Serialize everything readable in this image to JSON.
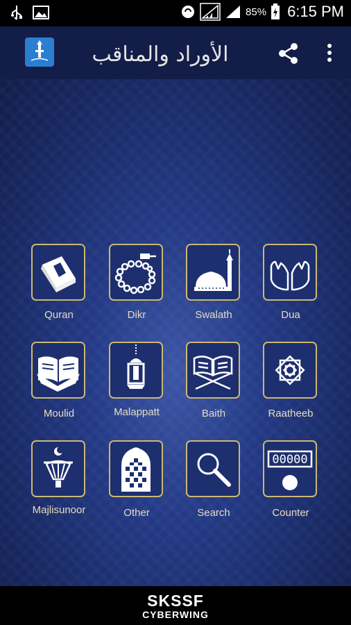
{
  "status_bar": {
    "battery": "85%",
    "time": "6:15 PM",
    "icons": [
      "usb-icon",
      "image-icon",
      "sync-icon",
      "signal-icon",
      "signal-icon",
      "battery-charging-icon"
    ]
  },
  "app_bar": {
    "title_arabic": "الأوراد والمناقب",
    "icons": [
      "app-logo-icon",
      "share-icon",
      "more-vert-icon"
    ]
  },
  "menu": [
    {
      "label": "Quran",
      "icon": "quran-book-icon"
    },
    {
      "label": "Dikr",
      "icon": "prayer-beads-icon"
    },
    {
      "label": "Swalath",
      "icon": "mosque-icon"
    },
    {
      "label": "Dua",
      "icon": "praying-hands-icon"
    },
    {
      "label": "Moulid",
      "icon": "open-book-icon"
    },
    {
      "label": "Malappatt",
      "icon": "lantern-icon"
    },
    {
      "label": "Baith",
      "icon": "book-stand-icon"
    },
    {
      "label": "Raatheeb",
      "icon": "star-pattern-icon"
    },
    {
      "label": "Majlisunoor",
      "icon": "lamp-crescent-icon"
    },
    {
      "label": "Other",
      "icon": "arch-window-icon"
    },
    {
      "label": "Search",
      "icon": "search-icon"
    },
    {
      "label": "Counter",
      "icon": "counter-icon"
    }
  ],
  "brand": {
    "line1": "SKSSF",
    "line2": "CYBERWING"
  },
  "colors": {
    "gold": "#cdb872",
    "app_bar": "#121e47",
    "label": "#e6dcc0",
    "main_bg": "#243a86"
  }
}
